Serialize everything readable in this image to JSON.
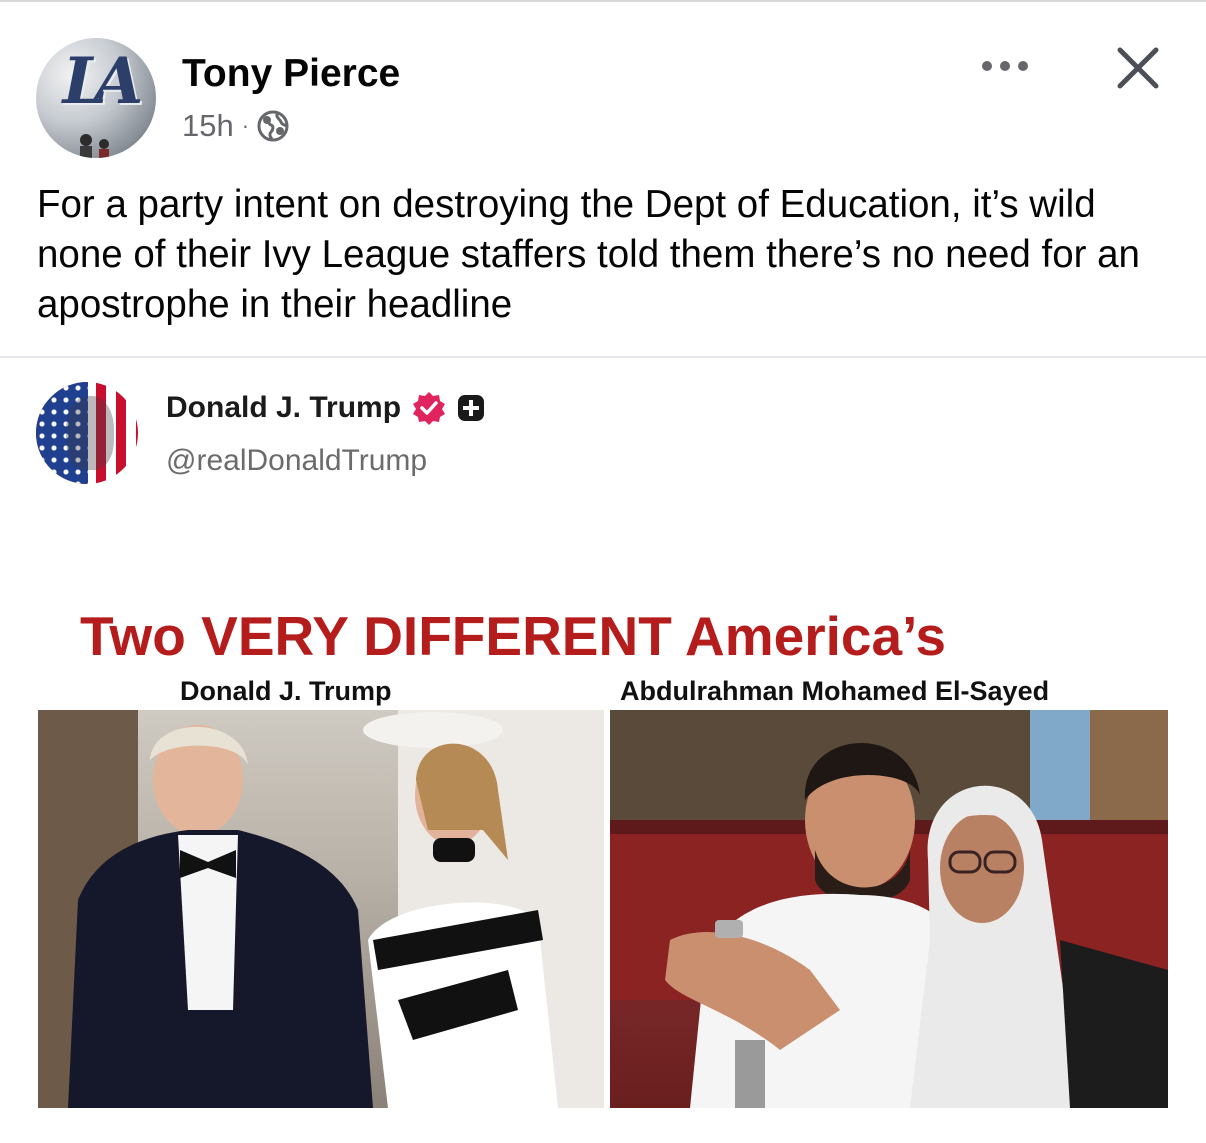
{
  "post": {
    "author": "Tony Pierce",
    "time": "15h",
    "separator": "·",
    "visibility_icon": "globe-icon",
    "text": "For a party intent on destroying the Dept of Education, it’s wild none of their Ivy League staffers told them there’s no need for an apostrophe in their headline"
  },
  "header_actions": {
    "more_icon": "more-options-icon",
    "close_icon": "close-icon"
  },
  "embedded": {
    "name": "Donald J. Trump",
    "handle": "@realDonaldTrump",
    "verified_icon": "verified-badge-icon",
    "extra_icon": "plus-badge-icon",
    "graphic_title": "Two VERY DIFFERENT America’s",
    "caption_left": "Donald J. Trump",
    "caption_right": "Abdulrahman Mohamed El-Sayed"
  },
  "colors": {
    "text": "#050505",
    "meta": "#65676b",
    "headline_red": "#b51d1d",
    "badge_pink": "#e0245e"
  }
}
